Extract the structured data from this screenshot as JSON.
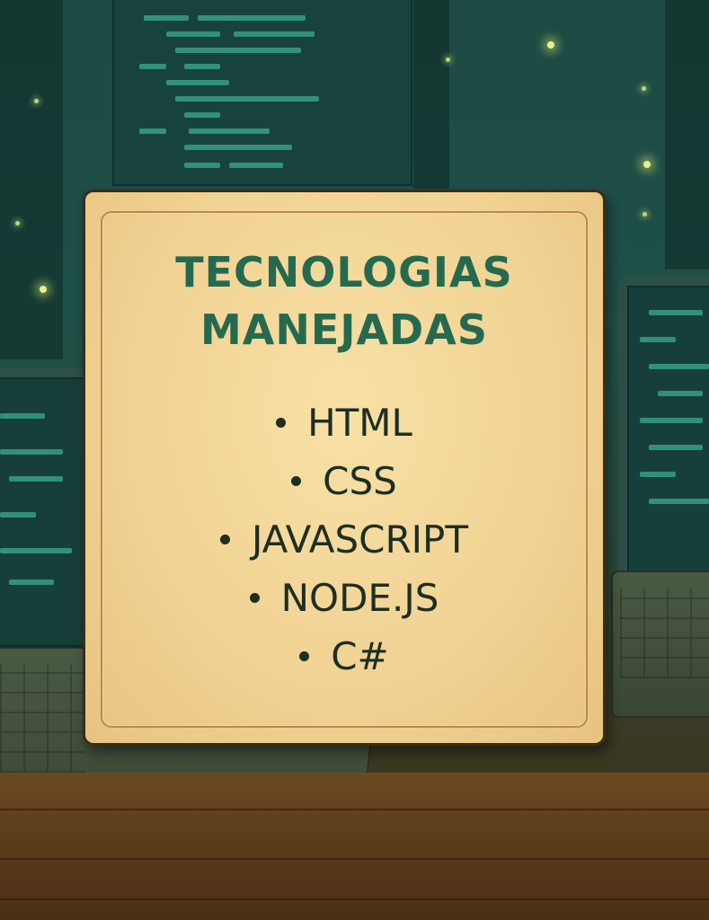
{
  "card": {
    "title_line1": "TECNOLOGIAS",
    "title_line2": "MANEJADAS",
    "items": [
      {
        "label": "HTML"
      },
      {
        "label": "CSS"
      },
      {
        "label": "JAVASCRIPT"
      },
      {
        "label": "NODE.JS"
      },
      {
        "label": "C#"
      }
    ]
  },
  "colors": {
    "title": "#256a4f",
    "text": "#1e2e22",
    "parchment": "#f3d697",
    "background": "#1f5148"
  }
}
